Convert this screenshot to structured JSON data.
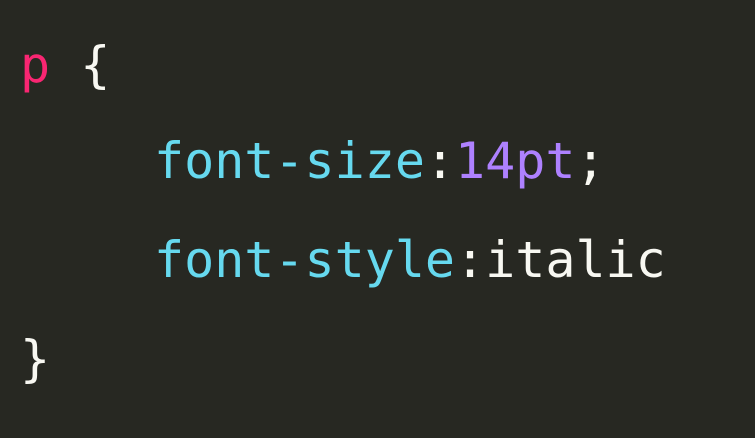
{
  "code": {
    "selector": "p",
    "open_brace": "{",
    "close_brace": "}",
    "declarations": [
      {
        "property": "font-size",
        "colon": ":",
        "value": "14pt",
        "semicolon": ";"
      },
      {
        "property": "font-style",
        "colon": ":",
        "value": "italic",
        "semicolon": ""
      }
    ]
  },
  "colors": {
    "background": "#272822",
    "selector": "#f92672",
    "property": "#66d9ef",
    "number": "#ae81ff",
    "text": "#f8f8f2"
  }
}
